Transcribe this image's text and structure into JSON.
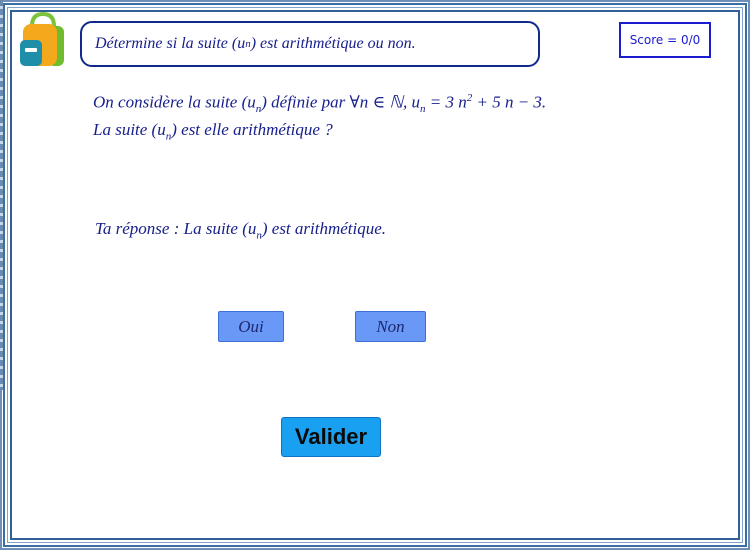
{
  "header": {
    "title": "Détermine si la suite (u",
    "title_sub": "n",
    "title_tail": ") est arithmétique ou non.",
    "score": "Score = 0/0"
  },
  "question": {
    "l1_a": "On considère la suite (u",
    "l1_sub": "n",
    "l1_b": ") définie par ∀n ∈ ℕ,  u",
    "l1_sub2": "n",
    "l1_c": " = 3 n",
    "l1_sup": "2",
    "l1_d": " + 5 n − 3.",
    "l2_a": "La suite (u",
    "l2_sub": "n",
    "l2_b": ") est elle arithmétique ?"
  },
  "answer": {
    "prefix": "Ta réponse :  La suite (u",
    "sub": "n",
    "tail": ") est arithmétique."
  },
  "choices": {
    "oui": "Oui",
    "non": "Non"
  },
  "actions": {
    "validate": "Valider"
  },
  "colors": {
    "text": "#18208c",
    "choice_bg": "#6a98f6",
    "validate_bg": "#1aa0f0",
    "score_border": "#1b1bd0"
  }
}
